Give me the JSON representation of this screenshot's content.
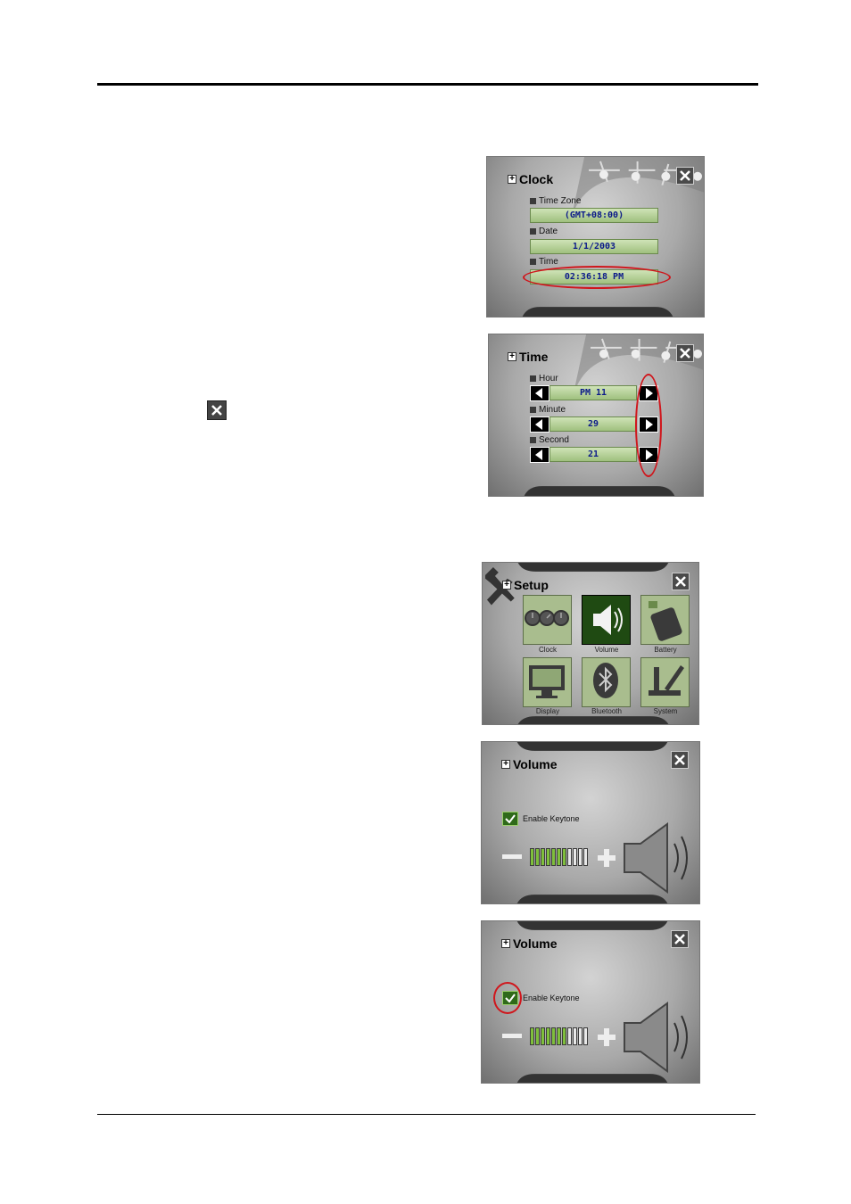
{
  "clock_panel": {
    "title": "Clock",
    "fields": [
      {
        "label": "Time Zone",
        "value": "(GMT+08:00)"
      },
      {
        "label": "Date",
        "value": "1/1/2003"
      },
      {
        "label": "Time",
        "value": "02:36:18 PM"
      }
    ]
  },
  "time_panel": {
    "title": "Time",
    "fields": [
      {
        "label": "Hour",
        "value": "PM 11"
      },
      {
        "label": "Minute",
        "value": "29"
      },
      {
        "label": "Second",
        "value": "21"
      }
    ]
  },
  "setup_panel": {
    "title": "Setup",
    "tiles": [
      {
        "label": "Clock",
        "icon": "clock-icon"
      },
      {
        "label": "Volume",
        "icon": "speaker-icon",
        "selected": true
      },
      {
        "label": "Battery",
        "icon": "battery-icon"
      },
      {
        "label": "Display",
        "icon": "monitor-icon"
      },
      {
        "label": "Bluetooth",
        "icon": "bluetooth-icon"
      },
      {
        "label": "System",
        "icon": "tools-icon"
      }
    ]
  },
  "volume_panel_1": {
    "title": "Volume",
    "keytone_label": "Enable Keytone",
    "keytone_checked": true,
    "volume_level": 7,
    "volume_max": 11
  },
  "volume_panel_2": {
    "title": "Volume",
    "keytone_label": "Enable Keytone",
    "keytone_checked": true,
    "volume_level": 7,
    "volume_max": 11
  },
  "colors": {
    "highlight": "#d0161c",
    "field_text": "#0b1a8a",
    "volume_on": "#7fbf3c"
  }
}
